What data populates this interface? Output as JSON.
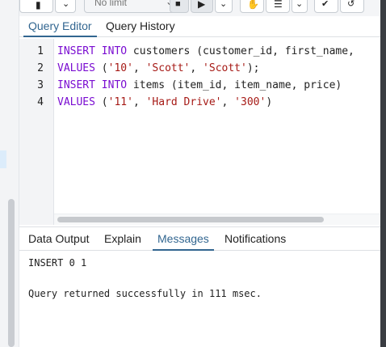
{
  "toolbar": {
    "limit_select": {
      "value": "No limit"
    },
    "icons": [
      "save-icon",
      "chevron-down-icon",
      "stop-icon",
      "play-icon",
      "chevron-down-icon",
      "hand-icon",
      "list-icon",
      "chevron-down-icon",
      "commit-icon",
      "rollback-icon"
    ]
  },
  "editor_tabs": [
    {
      "label": "Query Editor",
      "active": true
    },
    {
      "label": "Query History",
      "active": false
    }
  ],
  "editor": {
    "lines": [
      {
        "number": "1",
        "tokens": [
          {
            "t": "kw",
            "v": "INSERT"
          },
          {
            "t": "p",
            "v": " "
          },
          {
            "t": "kw",
            "v": "INTO"
          },
          {
            "t": "p",
            "v": " customers (customer_id, first_name,"
          }
        ]
      },
      {
        "number": "2",
        "tokens": [
          {
            "t": "kw",
            "v": "VALUES"
          },
          {
            "t": "p",
            "v": " ("
          },
          {
            "t": "str",
            "v": "'10'"
          },
          {
            "t": "p",
            "v": ", "
          },
          {
            "t": "str",
            "v": "'Scott'"
          },
          {
            "t": "p",
            "v": ", "
          },
          {
            "t": "str",
            "v": "'Scott'"
          },
          {
            "t": "p",
            "v": ");"
          }
        ]
      },
      {
        "number": "3",
        "tokens": [
          {
            "t": "kw",
            "v": "INSERT"
          },
          {
            "t": "p",
            "v": " "
          },
          {
            "t": "kw",
            "v": "INTO"
          },
          {
            "t": "p",
            "v": " items (item_id, item_name, price)"
          }
        ]
      },
      {
        "number": "4",
        "tokens": [
          {
            "t": "kw",
            "v": "VALUES"
          },
          {
            "t": "p",
            "v": " ("
          },
          {
            "t": "str",
            "v": "'11'"
          },
          {
            "t": "p",
            "v": ", "
          },
          {
            "t": "str",
            "v": "'Hard Drive'"
          },
          {
            "t": "p",
            "v": ", "
          },
          {
            "t": "str",
            "v": "'300'"
          },
          {
            "t": "p",
            "v": ")"
          }
        ]
      }
    ],
    "colors": {
      "keyword": "#7a0dd1",
      "string": "#a61a16",
      "text": "#222222"
    }
  },
  "results_tabs": [
    {
      "label": "Data Output",
      "active": false
    },
    {
      "label": "Explain",
      "active": false
    },
    {
      "label": "Messages",
      "active": true
    },
    {
      "label": "Notifications",
      "active": false
    }
  ],
  "messages": {
    "line1": "INSERT 0 1",
    "line2": "Query returned successfully in 111 msec."
  },
  "accent_color": "#326690"
}
